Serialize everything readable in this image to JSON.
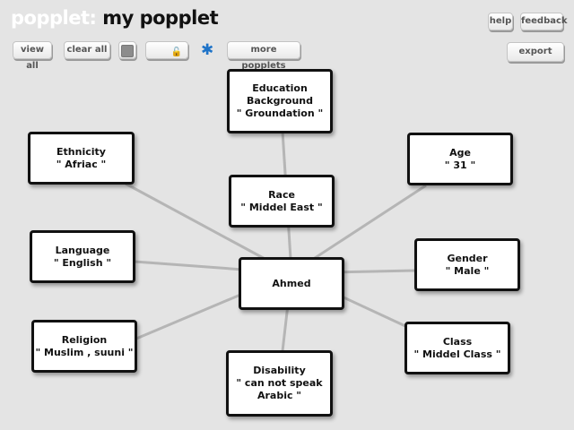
{
  "header": {
    "brand": "popplet:",
    "title": "my popplet"
  },
  "toolbar": {
    "view_all": "view all",
    "clear_all": "clear all",
    "more_popplets": "more popplets",
    "help": "help",
    "feedback": "feedback",
    "export": "export",
    "accent_color": "#1e73c8"
  },
  "nodes": {
    "education": {
      "lines": [
        "Education",
        "Background",
        "\" Groundation \""
      ]
    },
    "ethnicity": {
      "lines": [
        "Ethnicity",
        "\" Afriac \""
      ]
    },
    "age": {
      "lines": [
        "Age",
        "\" 31 \""
      ]
    },
    "race": {
      "lines": [
        "Race",
        "\" Middel East \""
      ]
    },
    "language": {
      "lines": [
        "Language",
        "\" English \""
      ]
    },
    "center": {
      "lines": [
        "Ahmed"
      ]
    },
    "gender": {
      "lines": [
        "Gender",
        "\" Male \""
      ]
    },
    "religion": {
      "lines": [
        "Religion",
        "\" Muslim , suuni \""
      ]
    },
    "class": {
      "lines": [
        "Class",
        "\" Middel Class \""
      ]
    },
    "disability": {
      "lines": [
        "Disability",
        "\" can not speak",
        "Arabic \""
      ]
    }
  }
}
